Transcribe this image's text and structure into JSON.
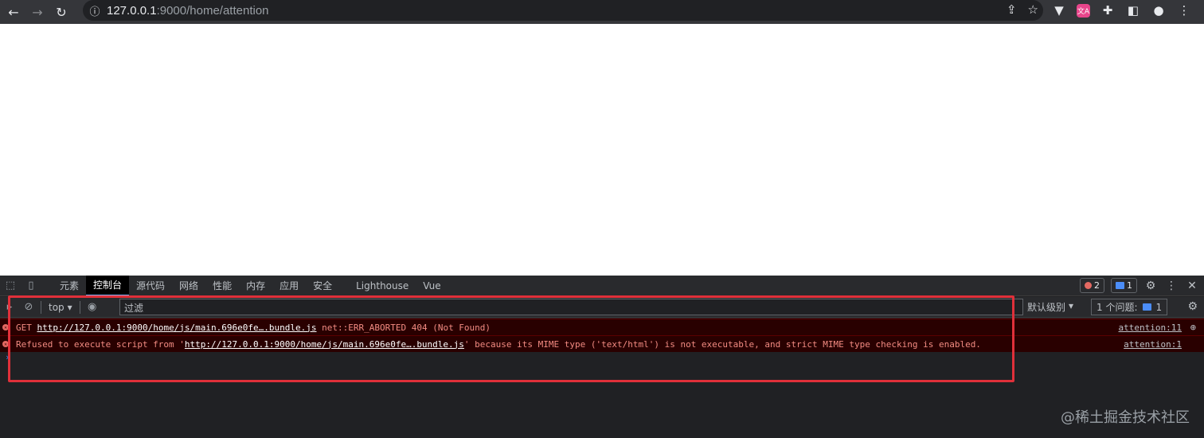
{
  "browser": {
    "url_host": "127.0.0.1",
    "url_path": ":9000/home/attention"
  },
  "devtools": {
    "tabs": [
      {
        "label": "元素"
      },
      {
        "label": "控制台"
      },
      {
        "label": "源代码"
      },
      {
        "label": "网络"
      },
      {
        "label": "性能"
      },
      {
        "label": "内存"
      },
      {
        "label": "应用"
      },
      {
        "label": "安全"
      },
      {
        "label": "Lighthouse"
      },
      {
        "label": "Vue"
      }
    ],
    "error_count": "2",
    "message_count": "1"
  },
  "console": {
    "context": "top",
    "filter_placeholder": "过滤",
    "levels": "默认级别",
    "issues_label": "1 个问题:",
    "issues_count": "1",
    "messages": [
      {
        "prefix": "GET ",
        "link": "http://127.0.0.1:9000/home/js/main.696e0fe….bundle.js",
        "suffix": " net::ERR_ABORTED 404 (Not Found)",
        "source": "attention:11"
      },
      {
        "prefix": "Refused to execute script from '",
        "link": "http://127.0.0.1:9000/home/js/main.696e0fe….bundle.js",
        "suffix": "' because its MIME type ('text/html') is not executable, and strict MIME type checking is enabled.",
        "source": "attention:1"
      }
    ]
  },
  "watermark": "@稀土掘金技术社区",
  "colors": {
    "error_bg": "#290000",
    "error_text": "#f28b82",
    "highlight_border": "#e0303a"
  }
}
